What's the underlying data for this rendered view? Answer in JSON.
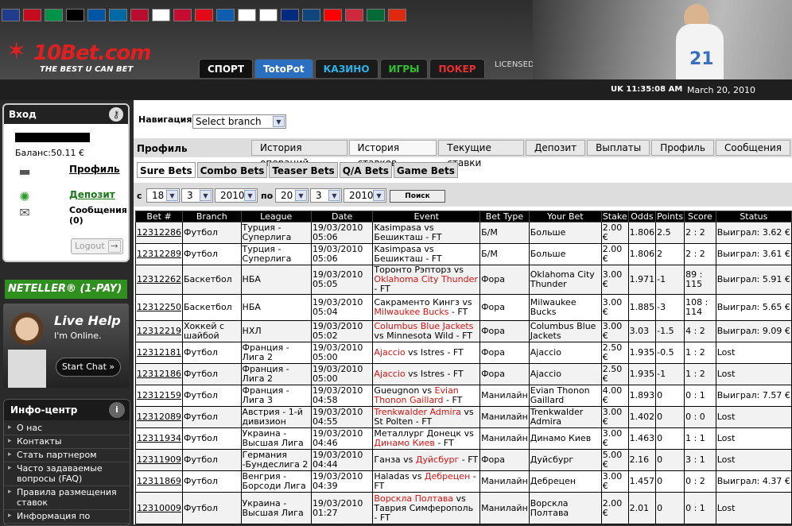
{
  "header": {
    "flags": [
      "gb",
      "es",
      "it",
      "de",
      "fr",
      "se",
      "no",
      "fi",
      "dk",
      "tr",
      "gr",
      "ru",
      "pl",
      "ro",
      "cz",
      "hr",
      "hu",
      "pt",
      "cn"
    ],
    "flag_colors": [
      "#203c8c",
      "#c60b1e",
      "#009246",
      "#000000",
      "#0055a4",
      "#006aa7",
      "#ba0c2f",
      "#ffffff",
      "#c60c30",
      "#e30a17",
      "#0d5eaf",
      "#ffffff",
      "#ffffff",
      "#002b7f",
      "#11457e",
      "#ff0000",
      "#cd2a3e",
      "#046a38",
      "#de2910"
    ],
    "logo_text": "10Bet.com",
    "tagline": "THE BEST U CAN BET",
    "nav": [
      {
        "label": "СПОРТ",
        "color": "#ffffff",
        "bg": "#111111"
      },
      {
        "label": "TotoPot",
        "color": "#ffffff",
        "bg": "#2a6fc0"
      },
      {
        "label": "КАЗИНО",
        "color": "#28b4e8",
        "bg": "#1b1b1b"
      },
      {
        "label": "ИГРЫ",
        "color": "#30c030",
        "bg": "#1b1b1b"
      },
      {
        "label": "ПОКЕР",
        "color": "#e83030",
        "bg": "#1b1b1b"
      }
    ],
    "licensed": "LICENSED AND REGULATED IN THE UK",
    "player_number": "21",
    "clock": "UK 11:35:08 AM",
    "date": "March 20, 2010"
  },
  "sidebar": {
    "login": {
      "title": "Вход",
      "balance": "Баланс:50.11 €",
      "links": [
        {
          "icon": "folder-icon",
          "label": "Профиль",
          "color": "#000000"
        },
        {
          "icon": "gear-icon",
          "label": "Депозит",
          "color": "#1a7a1a"
        },
        {
          "icon": "envelope-icon",
          "label": "Сообщения (0)",
          "color": "#000000"
        }
      ],
      "logout": "Logout"
    },
    "neteller": "NETELLER® (1-PAY)",
    "livehelp": {
      "title": "Live Help",
      "status": "I'm Online.",
      "button": "Start Chat »"
    },
    "info": {
      "title": "Инфо-центр",
      "items": [
        "О нас",
        "Контакты",
        "Стать партнером",
        "Часто задаваемые вопросы (FAQ)",
        "Правила размещения ставок",
        "Информация по"
      ]
    }
  },
  "main": {
    "nav_label": "Навигация:",
    "nav_select": "Select branch",
    "profile_label": "Профиль",
    "profile_tabs": [
      "История операций",
      "История ставков",
      "Текущие ставки",
      "Депозит",
      "Выплаты",
      "Профиль",
      "Сообщения"
    ],
    "bet_tabs": [
      "Sure Bets",
      "Combo Bets",
      "Teaser Bets",
      "Q/A Bets",
      "Game Bets"
    ],
    "search": {
      "from_label": "с",
      "to_label": "по",
      "from": [
        "18",
        "3",
        "2010"
      ],
      "to": [
        "20",
        "3",
        "2010"
      ],
      "button": "Поиск"
    },
    "columns": [
      "Bet #",
      "Branch",
      "League",
      "Date",
      "Event",
      "Bet Type",
      "Your Bet",
      "Stake",
      "Odds",
      "Points",
      "Score",
      "Status"
    ],
    "rows": [
      {
        "id": "12312286",
        "branch": "Футбол",
        "league": "Турция - Суперлига",
        "date": "19/03/2010 05:06",
        "ev1": "Kasimpasa",
        "ev1red": false,
        "vs": " vs ",
        "ev2": "Бешикташ",
        "ev2red": false,
        "suffix": " - FT",
        "type": "Б/М",
        "bet": "Больше",
        "stake": "2.00 €",
        "odds": "1.806",
        "points": "2.5",
        "score": "2 : 2",
        "status": "Выиграл: 3.62 €"
      },
      {
        "id": "12312289",
        "branch": "Футбол",
        "league": "Турция - Суперлига",
        "date": "19/03/2010 05:06",
        "ev1": "Kasimpasa",
        "ev1red": false,
        "vs": " vs ",
        "ev2": "Бешикташ",
        "ev2red": false,
        "suffix": " - FT",
        "type": "Б/М",
        "bet": "Больше",
        "stake": "2.00 €",
        "odds": "1.806",
        "points": "2",
        "score": "2 : 2",
        "status": "Выиграл: 3.61 €"
      },
      {
        "id": "12312262",
        "branch": "Баскетбол",
        "league": "НБА",
        "date": "19/03/2010 05:05",
        "ev1": "Торонто Рэпторз",
        "ev1red": false,
        "vs": " vs ",
        "ev2": "Oklahoma City Thunder",
        "ev2red": true,
        "suffix": " - FT",
        "type": "Фора",
        "bet": "Oklahoma City Thunder",
        "stake": "3.00 €",
        "odds": "1.971",
        "points": "-1",
        "score": "89 : 115",
        "status": "Выиграл: 5.91 €"
      },
      {
        "id": "12312250",
        "branch": "Баскетбол",
        "league": "НБА",
        "date": "19/03/2010 05:04",
        "ev1": "Сакраменто Кингз",
        "ev1red": false,
        "vs": " vs ",
        "ev2": "Milwaukee Bucks",
        "ev2red": true,
        "suffix": " - FT",
        "type": "Фора",
        "bet": "Milwaukee Bucks",
        "stake": "3.00 €",
        "odds": "1.885",
        "points": "-3",
        "score": "108 : 114",
        "status": "Выиграл: 5.65 €"
      },
      {
        "id": "12312219",
        "branch": "Хоккей с шайбой",
        "league": "НХЛ",
        "date": "19/03/2010 05:02",
        "ev1": "Columbus Blue Jackets",
        "ev1red": true,
        "vs": " vs ",
        "ev2": "Minnesota Wild",
        "ev2red": false,
        "suffix": " - FT",
        "type": "Фора",
        "bet": "Columbus Blue Jackets",
        "stake": "3.00 €",
        "odds": "3.03",
        "points": "-1.5",
        "score": "4 : 2",
        "status": "Выиграл: 9.09 €"
      },
      {
        "id": "12312181",
        "branch": "Футбол",
        "league": "Франция - Лига 2",
        "date": "19/03/2010 05:00",
        "ev1": "Ajaccio",
        "ev1red": true,
        "vs": " vs ",
        "ev2": "Istres",
        "ev2red": false,
        "suffix": " - FT",
        "type": "Фора",
        "bet": "Ajaccio",
        "stake": "2.50 €",
        "odds": "1.935",
        "points": "-0.5",
        "score": "1 : 2",
        "status": "Lost"
      },
      {
        "id": "12312186",
        "branch": "Футбол",
        "league": "Франция - Лига 2",
        "date": "19/03/2010 05:00",
        "ev1": "Ajaccio",
        "ev1red": true,
        "vs": " vs ",
        "ev2": "Istres",
        "ev2red": false,
        "suffix": " - FT",
        "type": "Фора",
        "bet": "Ajaccio",
        "stake": "2.50 €",
        "odds": "1.935",
        "points": "-1",
        "score": "1 : 2",
        "status": "Lost"
      },
      {
        "id": "12312159",
        "branch": "Футбол",
        "league": "Франция - Лига 3",
        "date": "19/03/2010 04:58",
        "ev1": "Gueugnon",
        "ev1red": false,
        "vs": " vs ",
        "ev2": "Evian Thonon Gaillard",
        "ev2red": true,
        "suffix": " - FT",
        "type": "Манилайн",
        "bet": "Evian Thonon Gaillard",
        "stake": "4.00 €",
        "odds": "1.893",
        "points": "0",
        "score": "0 : 1",
        "status": "Выиграл: 7.57 €"
      },
      {
        "id": "12312089",
        "branch": "Футбол",
        "league": "Австрия - 1-й дивизион",
        "date": "19/03/2010 04:55",
        "ev1": "Trenkwalder Admira",
        "ev1red": true,
        "vs": " vs ",
        "ev2": "St Polten",
        "ev2red": false,
        "suffix": " - FT",
        "type": "Манилайн",
        "bet": "Trenkwalder Admira",
        "stake": "3.00 €",
        "odds": "1.402",
        "points": "0",
        "score": "0 : 0",
        "status": "Lost"
      },
      {
        "id": "12311934",
        "branch": "Футбол",
        "league": "Украина - Высшая Лига",
        "date": "19/03/2010 04:46",
        "ev1": "Металлург Донецк",
        "ev1red": false,
        "vs": " vs ",
        "ev2": "Динамо Киев",
        "ev2red": true,
        "suffix": " - FT",
        "type": "Манилайн",
        "bet": "Динамо Киев",
        "stake": "3.00 €",
        "odds": "1.463",
        "points": "0",
        "score": "1 : 1",
        "status": "Lost"
      },
      {
        "id": "12311909",
        "branch": "Футбол",
        "league": "Германия -Бундеслига 2",
        "date": "19/03/2010 04:44",
        "ev1": "Ганза",
        "ev1red": false,
        "vs": " vs ",
        "ev2": "Дуйсбург",
        "ev2red": true,
        "suffix": " - FT",
        "type": "Фора",
        "bet": "Дуйсбург",
        "stake": "5.00 €",
        "odds": "2.16",
        "points": "0",
        "score": "3 : 1",
        "status": "Lost"
      },
      {
        "id": "12311869",
        "branch": "Футбол",
        "league": "Венгрия - Борсоди Лига",
        "date": "19/03/2010 04:39",
        "ev1": "Haladas",
        "ev1red": false,
        "vs": " vs ",
        "ev2": "Дебрецен",
        "ev2red": true,
        "suffix": " - FT",
        "type": "Манилайн",
        "bet": "Дебрецен",
        "stake": "3.00 €",
        "odds": "1.457",
        "points": "0",
        "score": "0 : 2",
        "status": "Выиграл: 4.37 €"
      },
      {
        "id": "12310009",
        "branch": "Футбол",
        "league": "Украина - Высшая Лига",
        "date": "19/03/2010 01:27",
        "ev1": "Ворскла Полтава",
        "ev1red": true,
        "vs": " vs ",
        "ev2": "Таврия Симферополь",
        "ev2red": false,
        "suffix": " - FT",
        "type": "Манилайн",
        "bet": "Ворскла Полтава",
        "stake": "2.00 €",
        "odds": "2.01",
        "points": "0",
        "score": "0 : 1",
        "status": "Lost"
      }
    ]
  }
}
